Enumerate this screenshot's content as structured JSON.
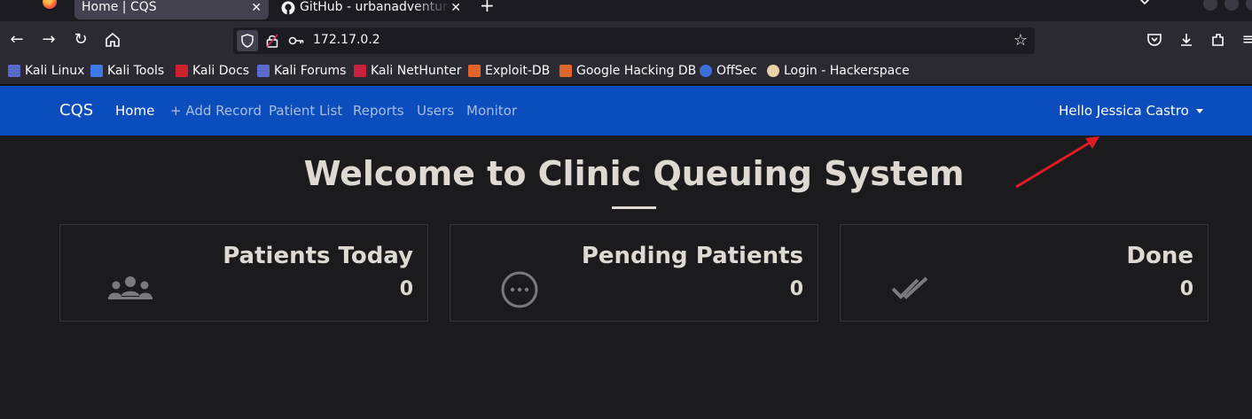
{
  "browser": {
    "tabs": [
      {
        "title": "Home | CQS"
      },
      {
        "title": "GitHub - urbanadventurer"
      }
    ],
    "url": "172.17.0.2",
    "bookmarks": [
      {
        "label": "Kali Linux",
        "icon": "kali-dragon-icon"
      },
      {
        "label": "Kali Tools",
        "icon": "kali-tools-icon"
      },
      {
        "label": "Kali Docs",
        "icon": "kali-docs-icon"
      },
      {
        "label": "Kali Forums",
        "icon": "kali-dragon-icon"
      },
      {
        "label": "Kali NetHunter",
        "icon": "nethunter-icon"
      },
      {
        "label": "Exploit-DB",
        "icon": "exploit-db-icon"
      },
      {
        "label": "Google Hacking DB",
        "icon": "exploit-db-icon"
      },
      {
        "label": "OffSec",
        "icon": "offsec-icon"
      },
      {
        "label": "Login - Hackerspace",
        "icon": "hackerspace-icon"
      }
    ]
  },
  "app": {
    "brand": "CQS",
    "nav": [
      {
        "label": "Home",
        "active": true
      },
      {
        "label": "+ Add Record",
        "active": false
      },
      {
        "label": "Patient List",
        "active": false
      },
      {
        "label": "Reports",
        "active": false
      },
      {
        "label": "Users",
        "active": false
      },
      {
        "label": "Monitor",
        "active": false
      }
    ],
    "user_greeting": "Hello Jessica Castro",
    "accent_color": "#0b4dbd"
  },
  "main": {
    "title": "Welcome to Clinic Queuing System",
    "cards": [
      {
        "label": "Patients Today",
        "value": "0",
        "icon": "users-group-icon"
      },
      {
        "label": "Pending Patients",
        "value": "0",
        "icon": "ellipsis-circle-icon"
      },
      {
        "label": "Done",
        "value": "0",
        "icon": "double-check-icon"
      }
    ]
  },
  "annotation": {
    "color": "#e01b24",
    "icon": "red-arrow"
  }
}
